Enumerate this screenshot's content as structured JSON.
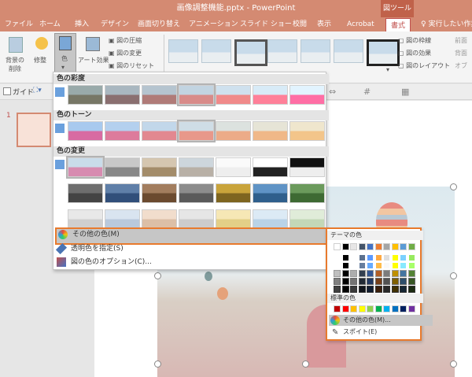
{
  "window": {
    "title": "画像調整機能.pptx - PowerPoint",
    "tool_context": "図ツール"
  },
  "tabs": [
    "ファイル",
    "ホーム",
    "挿入",
    "デザイン",
    "画面切り替え",
    "アニメーション",
    "スライド ショー",
    "校閲",
    "表示",
    "Acrobat",
    "書式"
  ],
  "active_tab": "書式",
  "tell_me": "実行したい作業を",
  "ribbon": {
    "remove_bg": "背景の削除",
    "corrections": "修整",
    "color": "色",
    "artistic": "アート効果",
    "compress": "図の圧縮",
    "change": "図の変更",
    "reset": "図のリセット",
    "border": "図の枠線",
    "effects": "図の効果",
    "layout": "図のレイアウト",
    "front": "前面",
    "back": "背面",
    "select": "オブ"
  },
  "subbar": {
    "guide": "ガイド"
  },
  "slide_number": "1",
  "dropdown": {
    "saturation_header": "色の彩度",
    "tone_header": "色のトーン",
    "recolor_header": "色の変更",
    "more_colors": "その他の色(M)",
    "set_transparent": "透明色を指定(S)",
    "color_options": "図の色のオプション(C)..."
  },
  "submenu": {
    "theme_colors": "テーマの色",
    "standard_colors": "標準の色",
    "more_colors": "その他の色(M)...",
    "eyedropper": "スポイト(E)"
  },
  "colors": {
    "accent": "#d48a72",
    "highlight_border": "#e87a2d",
    "theme_row": [
      "#ffffff",
      "#000000",
      "#e7e6e6",
      "#44546a",
      "#4472c4",
      "#ed7d31",
      "#a5a5a5",
      "#ffc000",
      "#5b9bd5",
      "#70ad47"
    ],
    "standard_row": [
      "#c00000",
      "#ff0000",
      "#ffc000",
      "#ffff00",
      "#92d050",
      "#00b050",
      "#00b0f0",
      "#0070c0",
      "#002060",
      "#7030a0"
    ]
  }
}
